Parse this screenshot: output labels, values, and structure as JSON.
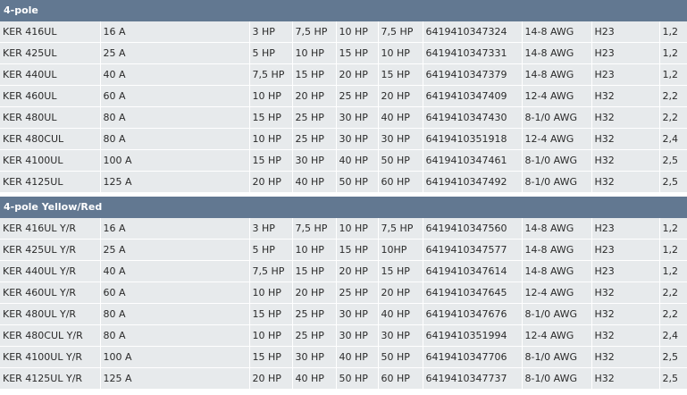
{
  "sections": [
    {
      "title": "4-pole",
      "rows": [
        [
          "KER 416UL",
          "16 A",
          "3 HP",
          "7,5 HP",
          "10 HP",
          "7,5 HP",
          "6419410347324",
          "14-8 AWG",
          "H23",
          "1,2"
        ],
        [
          "KER 425UL",
          "25 A",
          "5 HP",
          "10 HP",
          "15 HP",
          "10 HP",
          "6419410347331",
          "14-8 AWG",
          "H23",
          "1,2"
        ],
        [
          "KER 440UL",
          "40 A",
          "7,5 HP",
          "15 HP",
          "20 HP",
          "15 HP",
          "6419410347379",
          "14-8 AWG",
          "H23",
          "1,2"
        ],
        [
          "KER 460UL",
          "60 A",
          "10 HP",
          "20 HP",
          "25 HP",
          "20 HP",
          "6419410347409",
          "12-4 AWG",
          "H32",
          "2,2"
        ],
        [
          "KER 480UL",
          "80 A",
          "15 HP",
          "25 HP",
          "30 HP",
          "40 HP",
          "6419410347430",
          "8-1/0 AWG",
          "H32",
          "2,2"
        ],
        [
          "KER 480CUL",
          "80 A",
          "10 HP",
          "25 HP",
          "30 HP",
          "30 HP",
          "6419410351918",
          "12-4 AWG",
          "H32",
          "2,4"
        ],
        [
          "KER 4100UL",
          "100 A",
          "15 HP",
          "30 HP",
          "40 HP",
          "50 HP",
          "6419410347461",
          "8-1/0 AWG",
          "H32",
          "2,5"
        ],
        [
          "KER 4125UL",
          "125 A",
          "20 HP",
          "40 HP",
          "50 HP",
          "60 HP",
          "6419410347492",
          "8-1/0 AWG",
          "H32",
          "2,5"
        ]
      ]
    },
    {
      "title": "4-pole Yellow/Red",
      "rows": [
        [
          "KER 416UL Y/R",
          "16 A",
          "3 HP",
          "7,5 HP",
          "10 HP",
          "7,5 HP",
          "6419410347560",
          "14-8 AWG",
          "H23",
          "1,2"
        ],
        [
          "KER 425UL Y/R",
          "25 A",
          "5 HP",
          "10 HP",
          "15 HP",
          "10HP",
          "6419410347577",
          "14-8 AWG",
          "H23",
          "1,2"
        ],
        [
          "KER 440UL Y/R",
          "40 A",
          "7,5 HP",
          "15 HP",
          "20 HP",
          "15 HP",
          "6419410347614",
          "14-8 AWG",
          "H23",
          "1,2"
        ],
        [
          "KER 460UL Y/R",
          "60 A",
          "10 HP",
          "20 HP",
          "25 HP",
          "20 HP",
          "6419410347645",
          "12-4 AWG",
          "H32",
          "2,2"
        ],
        [
          "KER 480UL Y/R",
          "80 A",
          "15 HP",
          "25 HP",
          "30 HP",
          "40 HP",
          "6419410347676",
          "8-1/0 AWG",
          "H32",
          "2,2"
        ],
        [
          "KER 480CUL Y/R",
          "80 A",
          "10 HP",
          "25 HP",
          "30 HP",
          "30 HP",
          "6419410351994",
          "12-4 AWG",
          "H32",
          "2,4"
        ],
        [
          "KER 4100UL Y/R",
          "100 A",
          "15 HP",
          "30 HP",
          "40 HP",
          "50 HP",
          "6419410347706",
          "8-1/0 AWG",
          "H32",
          "2,5"
        ],
        [
          "KER 4125UL Y/R",
          "125 A",
          "20 HP",
          "40 HP",
          "50 HP",
          "60 HP",
          "6419410347737",
          "8-1/0 AWG",
          "H32",
          "2,5"
        ]
      ]
    }
  ]
}
